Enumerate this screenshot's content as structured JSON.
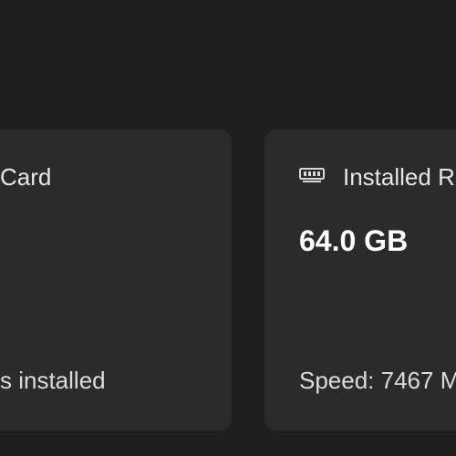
{
  "cards": [
    {
      "title": "Card",
      "value": "",
      "footer": "s installed"
    },
    {
      "icon": "ram-icon",
      "title": "Installed R",
      "value": "64.0 GB",
      "footer": "Speed: 7467 M"
    }
  ],
  "colors": {
    "background": "#1f1f1f",
    "card": "#2b2b2b",
    "text": "#ffffff"
  }
}
